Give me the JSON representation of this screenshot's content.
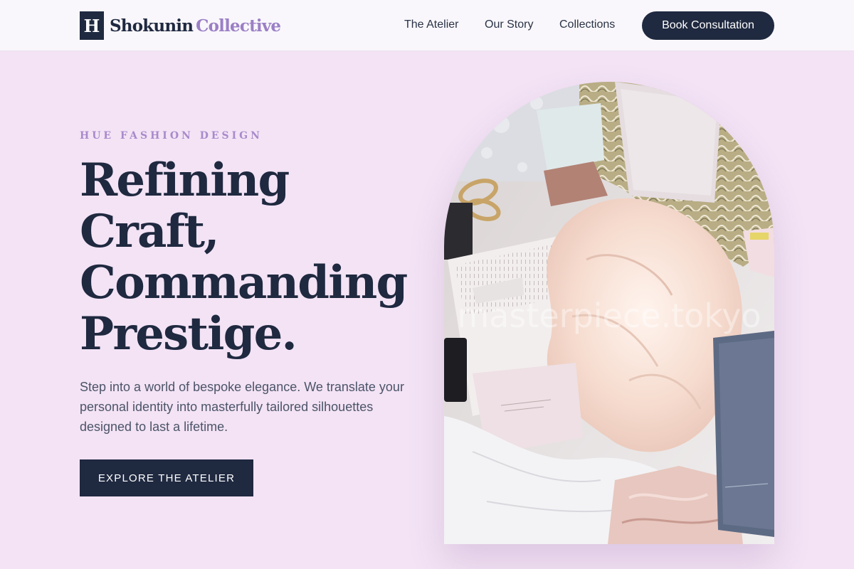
{
  "header": {
    "logo_mark": "H",
    "brand_primary": "Shokunin",
    "brand_secondary": "Collective",
    "nav": [
      "The Atelier",
      "Our Story",
      "Collections"
    ],
    "cta_label": "Book Consultation"
  },
  "hero": {
    "eyebrow": "HUE FASHION DESIGN",
    "headline": [
      "Refining",
      "Craft,",
      "Commanding",
      "Prestige."
    ],
    "subtext": "Step into a world of bespoke elegance. We translate your personal identity into masterfully tailored silhouettes designed to last a lifetime.",
    "button_label": "EXPLORE THE ATELIER",
    "image_watermark": "masterpiece.tokyo"
  },
  "colors": {
    "background": "#f3e3f5",
    "navy": "#1f2940",
    "accent_lavender": "#9b7fc6",
    "header_bg": "#f9f7fb"
  },
  "icons": {
    "logo_mark": "letter-h-logo-icon"
  }
}
